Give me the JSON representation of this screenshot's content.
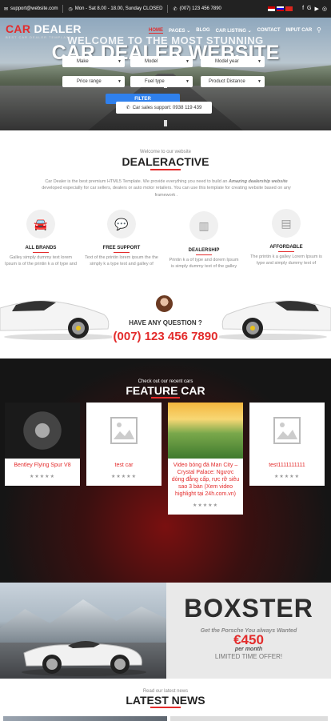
{
  "topbar": {
    "email": "support@website.com",
    "hours": "Mon - Sat 8.00 - 18.00, Sunday CLOSED",
    "phone": "(007) 123 456 7890",
    "social": [
      "f",
      "G",
      "▶",
      "◎"
    ]
  },
  "header": {
    "logo_car": "CAR",
    "logo_dealer": "DEALER",
    "logo_tagline": "BEST CAR DEALER TEMPLATE",
    "nav": [
      "HOME",
      "PAGES",
      "BLOG",
      "CAR LISTING",
      "CONTACT",
      "INPUT CAR"
    ]
  },
  "hero": {
    "welcome": "WELCOME TO THE MOST STUNNING",
    "title": "CAR DEALER WEBSITE",
    "selects": [
      "Make",
      "Model",
      "Model year",
      "Price range",
      "Fuel type",
      "Product Distance"
    ],
    "filter": "FILTER",
    "support": "Car sales support: 0938 119 439"
  },
  "about": {
    "small": "Welcome to our website",
    "title": "DEALERACTIVE",
    "desc_1": "Car Dealer is the best premium HTML5 Template. We provide everything you need to build an",
    "desc_em": "Amazing dealership website",
    "desc_2": "developed especially for car sellers, dealers or auto motor retailers. You can use this template for creating website based on any framework .",
    "features": [
      {
        "title": "ALL BRANDS",
        "desc": "Galley simply dummy text lorem Ipsum is of the printin k a of type and"
      },
      {
        "title": "FREE SUPPORT",
        "desc": "Text of the printin lorem ipsum the the simply k a type text and galley of"
      },
      {
        "title": "DEALERSHIP",
        "desc": "Printin k a of type and dorem Ipsum is simply dummy text of the galley"
      },
      {
        "title": "AFFORDABLE",
        "desc": "The printin k a galley Lorem Ipsum is type and simply dummy text of"
      }
    ]
  },
  "contact": {
    "question": "HAVE ANY QUESTION ?",
    "phone": "(007) 123 456 7890"
  },
  "featured": {
    "small": "Check out our recent cars",
    "title": "FEATURE CAR",
    "cars": [
      {
        "title": "Bentley Flying Spur V8",
        "stars": "★★★★★"
      },
      {
        "title": "test car",
        "stars": "★★★★★"
      },
      {
        "title": "Video bóng đá Man City – Crystal Palace: Ngược dòng đẳng cấp, rực rỡ siêu sao 3 bàn (Xem video highlight tại 24h.com.vn)",
        "stars": "★★★★★"
      },
      {
        "title": "test1111111111",
        "stars": "★★★★★"
      }
    ]
  },
  "promo": {
    "title": "BOXSTER",
    "sub": "Get the Porsche You always Wanted",
    "price": "€450",
    "per": "per month",
    "limited": "LIMITED TIME OFFER!"
  },
  "news": {
    "small": "Read our latest news",
    "title": "LATEST NEWS"
  },
  "colors": {
    "accent": "#e32b2b",
    "filter": "#2f80ed"
  }
}
